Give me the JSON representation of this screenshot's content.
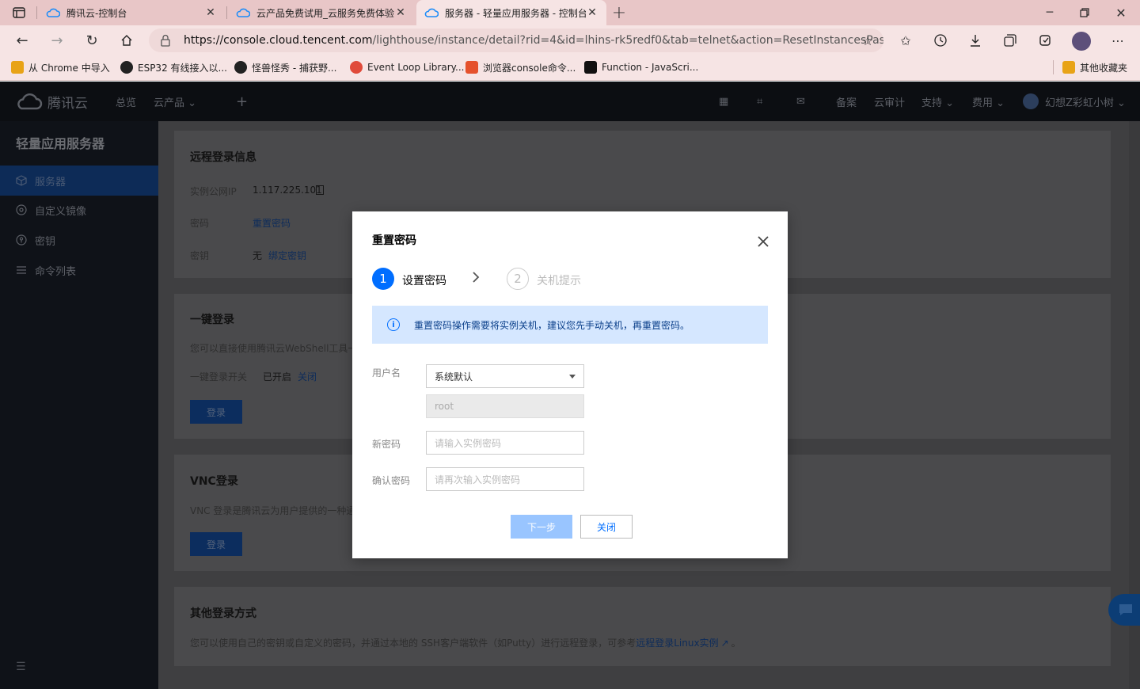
{
  "browser": {
    "tabs": [
      {
        "title": "腾讯云-控制台"
      },
      {
        "title": "云产品免费试用_云服务免费体验"
      },
      {
        "title": "服务器 - 轻量应用服务器 - 控制台"
      }
    ],
    "url_host": "https://console.cloud.tencent.com",
    "url_rest": "/lighthouse/instance/detail?rid=4&id=lhins-rk5redf0&tab=telnet&action=ResetInstancesPassword",
    "bookmarks": [
      {
        "label": "从 Chrome 中导入",
        "color": "#e8a317"
      },
      {
        "label": "ESP32 有线接入以...",
        "color": "#222222"
      },
      {
        "label": "怪兽怪秀 - 捕获野...",
        "color": "#222222"
      },
      {
        "label": "Event Loop Library...",
        "color": "#e04a3a"
      },
      {
        "label": "浏览器console命令...",
        "color": "#e5512c"
      },
      {
        "label": "Function - JavaScri...",
        "color": "#111111"
      }
    ],
    "other_bookmarks": "其他收藏夹"
  },
  "console_nav": {
    "brand": "腾讯云",
    "overview": "总览",
    "products": "云产品 ⌄",
    "plus": "+",
    "beian": "备案",
    "audit": "云审计",
    "support": "支持 ⌄",
    "billing": "费用 ⌄",
    "user": "幻想Z彩虹小树 ⌄"
  },
  "sidebar": {
    "title": "轻量应用服务器",
    "items": [
      {
        "label": "服务器",
        "icon": "cube-icon"
      },
      {
        "label": "自定义镜像",
        "icon": "disc-icon"
      },
      {
        "label": "密钥",
        "icon": "key-icon"
      },
      {
        "label": "命令列表",
        "icon": "list-icon"
      }
    ]
  },
  "remote_info": {
    "title": "远程登录信息",
    "ip_label": "实例公网IP",
    "ip_value": "1.117.225.101",
    "pwd_label": "密码",
    "pwd_link": "重置密码",
    "key_label": "密钥",
    "key_value": "无",
    "key_link": "绑定密钥"
  },
  "one_click": {
    "title": "一键登录",
    "desc": "您可以直接使用腾讯云WebShell工具一",
    "switch_label": "一键登录开关",
    "switch_value": "已开启",
    "switch_link": "关闭",
    "button": "登录"
  },
  "vnc": {
    "title": "VNC登录",
    "desc": "VNC 登录是腾讯云为用户提供的一种通",
    "button": "登录"
  },
  "other_login": {
    "title": "其他登录方式",
    "desc": "您可以使用自己的密钥或自定义的密码，并通过本地的 SSH客户端软件（如Putty）进行远程登录，可参考",
    "link": "远程登录Linux实例",
    "end": "。"
  },
  "modal": {
    "title": "重置密码",
    "step1_num": "1",
    "step1_label": "设置密码",
    "step2_num": "2",
    "step2_label": "关机提示",
    "notice": "重置密码操作需要将实例关机，建议您先手动关机，再重置密码。",
    "username_label": "用户名",
    "username_value": "系统默认",
    "username_fixed": "root",
    "new_pwd_label": "新密码",
    "new_pwd_placeholder": "请输入实例密码",
    "confirm_label": "确认密码",
    "confirm_placeholder": "请再次输入实例密码",
    "next_button": "下一步",
    "close_button": "关闭"
  },
  "colors": {
    "accent": "#006eff",
    "notice_bg": "#d5e7ff"
  }
}
